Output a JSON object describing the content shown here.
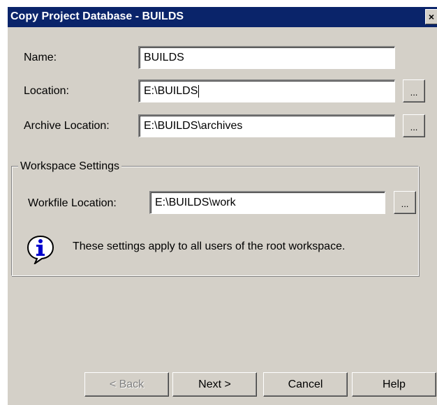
{
  "window": {
    "title": "Copy Project Database - BUILDS",
    "close_glyph": "×"
  },
  "fields": {
    "name": {
      "label": "Name:",
      "value": "BUILDS"
    },
    "location": {
      "label": "Location:",
      "value": "E:\\BUILDS"
    },
    "archive_location": {
      "label": "Archive Location:",
      "value": "E:\\BUILDS\\archives"
    }
  },
  "workspace": {
    "group_label": "Workspace Settings",
    "workfile": {
      "label": "Workfile Location:",
      "value": "E:\\BUILDS\\work"
    },
    "info_text": "These settings apply to all users of the root workspace."
  },
  "browse_label": "...",
  "buttons": {
    "back": "< Back",
    "next": "Next >",
    "cancel": "Cancel",
    "help": "Help"
  },
  "colors": {
    "titlebar": "#0a246a",
    "dialog_bg": "#d4d0c8",
    "info_icon": "#0000cc"
  },
  "icons": {
    "info": "info-icon",
    "close": "close-icon"
  }
}
